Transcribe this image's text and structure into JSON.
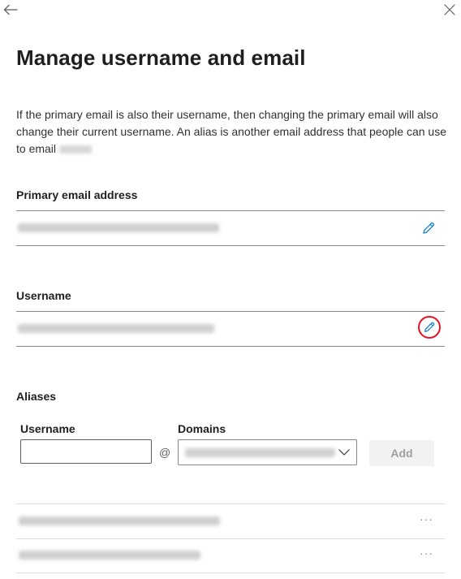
{
  "page": {
    "title": "Manage username and email",
    "description": "If the primary email is also their username, then changing the primary email will also change their current username. An alias is another email address that people can use to email"
  },
  "nav": {
    "back_icon": "back-arrow-icon",
    "close_icon": "close-icon"
  },
  "primary_email": {
    "label": "Primary email address",
    "edit_icon": "pencil-icon"
  },
  "username": {
    "label": "Username",
    "edit_icon": "pencil-icon"
  },
  "aliases": {
    "label": "Aliases",
    "username_label": "Username",
    "username_value": "",
    "at_symbol": "@",
    "domains_label": "Domains",
    "add_label": "Add",
    "more_label": "···"
  },
  "colors": {
    "highlight_ring": "#e81123",
    "edit_icon": "#0078d4",
    "text": "#323130"
  }
}
